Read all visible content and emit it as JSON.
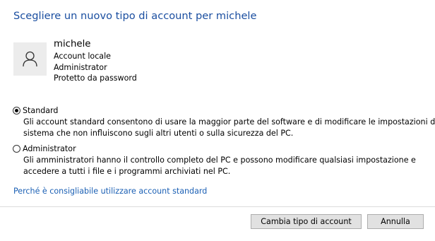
{
  "dialog": {
    "title": "Scegliere un nuovo tipo di account per michele"
  },
  "user": {
    "avatar_icon": "user-icon",
    "name": "michele",
    "details": [
      "Account locale",
      "Administrator",
      "Protetto da password"
    ]
  },
  "options": [
    {
      "label": "Standard",
      "selected": true,
      "description": [
        "Gli account standard consentono di usare la maggior parte del software e di modificare le impostazioni del",
        "sistema che non influiscono sugli altri utenti o sulla sicurezza del PC."
      ]
    },
    {
      "label": "Administrator",
      "selected": false,
      "description": [
        "Gli amministratori hanno il controllo completo del PC e possono modificare qualsiasi impostazione e",
        "accedere a tutti i file e i programmi archiviati nel PC."
      ]
    }
  ],
  "help_link": "Perché è consigliabile utilizzare account standard",
  "buttons": {
    "change_label": "Cambia tipo di account",
    "cancel_label": "Annulla"
  },
  "colors": {
    "title": "#1a4ea0",
    "link": "#1a5fb4",
    "button_bg": "#e1e1e1"
  }
}
